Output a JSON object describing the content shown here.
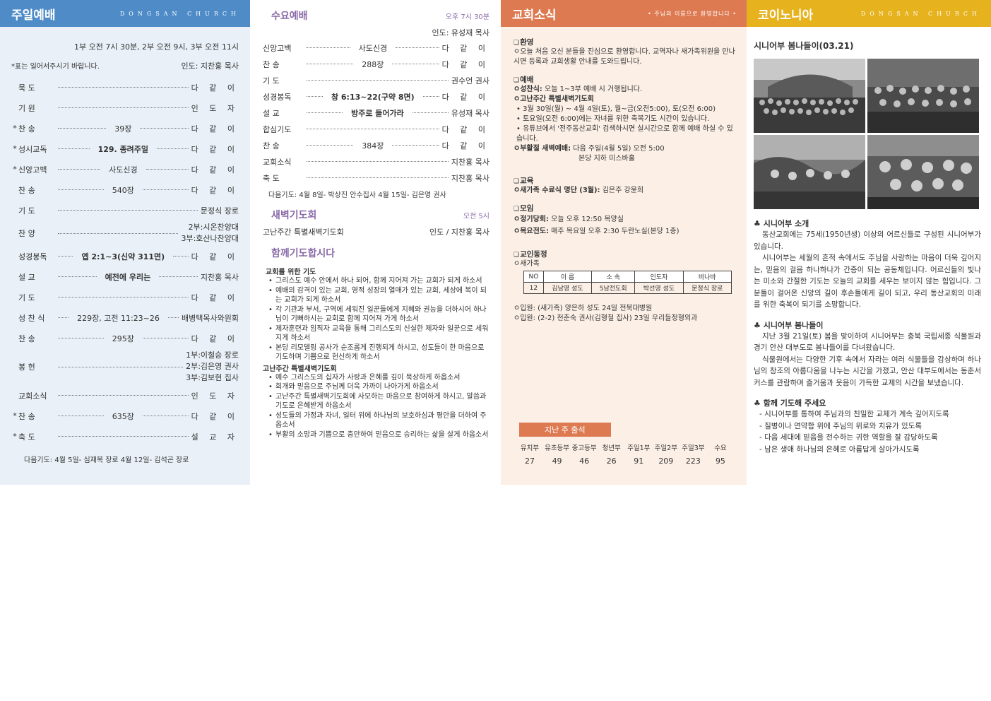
{
  "col1": {
    "title": "주일예배",
    "church": "DONGSAN CHURCH",
    "times": "1부 오전 7시 30분, 2부 오전 9시, 3부 오전 11시",
    "note": "*표는 일어서주시기 바랍니다.",
    "leader": "인도: 지찬홍 목사",
    "rows": [
      {
        "star": "",
        "label": "묵 도",
        "mid": "",
        "end": "다 같 이"
      },
      {
        "star": "",
        "label": "기 원",
        "mid": "",
        "end": "인 도 자"
      },
      {
        "star": "*",
        "label": "찬 송",
        "mid": "39장",
        "end": "다 같 이"
      },
      {
        "star": "*",
        "label": "성시교독",
        "mid": "129. 종려주일",
        "end": "다 같 이"
      },
      {
        "star": "*",
        "label": "신앙고백",
        "mid": "사도신경",
        "end": "다 같 이"
      },
      {
        "star": "",
        "label": "찬 송",
        "mid": "540장",
        "end": "다 같 이"
      },
      {
        "star": "",
        "label": "기 도",
        "mid": "",
        "end": "문정식 장로"
      },
      {
        "star": "",
        "label": "찬 양",
        "mid": "",
        "end1": "2부:시온찬양대",
        "end2": "3부:호산나찬양대"
      },
      {
        "star": "",
        "label": "성경봉독",
        "mid": "엡 2:1~3(신약 311면)",
        "end": "다 같 이"
      },
      {
        "star": "",
        "label": "설 교",
        "mid": "예전에 우리는",
        "end": "지찬홍 목사"
      },
      {
        "star": "",
        "label": "기 도",
        "mid": "",
        "end": "다 같 이"
      },
      {
        "star": "",
        "label": "성 찬 식",
        "mid": "229장, 고전 11:23~26",
        "end": "배병택목사와원회"
      },
      {
        "star": "",
        "label": "찬 송",
        "mid": "295장",
        "end": "다 같 이"
      },
      {
        "star": "",
        "label": "봉 헌",
        "mid": "",
        "end1": "1부:이철승 장로",
        "end2": "2부:김은영 권사",
        "end3": "3부:김보현 집사"
      },
      {
        "star": "",
        "label": "교회소식",
        "mid": "",
        "end": "인 도 자"
      },
      {
        "star": "*",
        "label": "찬 송",
        "mid": "635장",
        "end": "다 같 이"
      },
      {
        "star": "*",
        "label": "축 도",
        "mid": "",
        "end": "설 교 자"
      }
    ],
    "next": "다음기도: 4월 5일- 심재복 장로       4월 12일- 김석곤 장로"
  },
  "col2": {
    "title": "수요예배",
    "time": "오후 7시 30분",
    "leader": "인도: 유성재 목사",
    "rows": [
      {
        "label": "신앙고백",
        "mid": "사도신경",
        "end": "다 같 이"
      },
      {
        "label": "찬 송",
        "mid": "288장",
        "end": "다 같 이"
      },
      {
        "label": "기 도",
        "mid": "",
        "end": "권수언 권사"
      },
      {
        "label": "성경봉독",
        "mid": "창 6:13~22(구약 8면)",
        "end": "다 같 이"
      },
      {
        "label": "설 교",
        "mid": "방주로 들어가라",
        "end": "유성재 목사"
      },
      {
        "label": "합심기도",
        "mid": "",
        "end": "다 같 이"
      },
      {
        "label": "찬 송",
        "mid": "384장",
        "end": "다 같 이"
      },
      {
        "label": "교회소식",
        "mid": "",
        "end": "지찬홍 목사"
      },
      {
        "label": "축 도",
        "mid": "",
        "end": "지찬홍 목사"
      }
    ],
    "next": "다음기도: 4월 8일- 박상진 안수집사      4월 15일- 김은영 권사",
    "dawn_title": "새벽기도회",
    "dawn_time": "오전 5시",
    "dawn_name": "고난주간 특별새벽기도회",
    "dawn_leader": "인도 / 지찬홍 목사",
    "pray_title": "함께기도합시다",
    "pray_h1": "교회를 위한 기도",
    "pray_items1": [
      "그리스도 예수 안에서 하나 되어, 함께 지어져 가는 교회가 되게 하소서",
      "예배의 감격이 있는 교회, 영적 성장의 열매가 있는 교회, 세상에 복이 되는 교회가 되게 하소서",
      "각 기관과 부서, 구역에 세워진 일꾼들에게 지혜와 권능을 더하시어 하나님이 기뻐하시는 교회로 함께 지어져 가게 하소서",
      "제자훈련과 임직자 교육을 통해 그리스도의 신실한 제자와 일꾼으로 세워지게 하소서",
      "본당 리모델링 공사가 순조롭게 진행되게 하시고, 성도들이 한 마음으로 기도하며 기쁨으로 헌신하게 하소서"
    ],
    "pray_h2": "고난주간 특별새벽기도회",
    "pray_items2": [
      "예수 그리스도의 십자가 사랑과 은혜를 깊이 묵상하게 하옵소서",
      "회개와 믿음으로 주님께 더욱 가까이 나아가게 하옵소서",
      "고난주간 특별새벽기도회에 사모하는 마음으로 참여하게 하시고, 말씀과 기도로 은혜받게 하옵소서",
      "성도들의 가정과 자녀, 일터 위에 하나님의 보호하심과 평안을 더하여 주옵소서",
      "부활의 소망과 기쁨으로 충만하여 믿음으로 승리하는 삶을 살게 하옵소서"
    ]
  },
  "col3": {
    "title": "교회소식",
    "motto": "• 주님의 이름으로 환영합니다 •",
    "welcome_h": "환영",
    "welcome": "ㅇ오늘 처음 오신 분들을 진심으로 환영합니다. 교역자나 새가족위원을 만나시면 등록과 교회생활 안내를 도와드립니다.",
    "worship_h": "예배",
    "worship_1b": "ㅇ성찬식:",
    "worship_1": " 오늘 1~3부 예배 시 거행됩니다.",
    "worship_2b": "ㅇ고난주간 특별새벽기도회",
    "worship_2a": "• 3월 30일(월) ~ 4월 4일(토), 월~금(오전5:00), 토(오전 6:00)",
    "worship_2c": "• 토요일(오전 6:00)에는 자녀를 위한 축복기도 시간이 있습니다.",
    "worship_2d": "• 유튜브에서 '전주동산교회' 검색하시면 실시간으로 함께 예배 하실 수 있습니다.",
    "worship_3b": "ㅇ부활절 새벽예배:",
    "worship_3": " 다음 주일(4월 5일) 오전 5:00",
    "worship_3x": "본당 지하 미스바홀",
    "edu_h": "교육",
    "edu_b": "ㅇ새가족 수료식 명단 (3월):",
    "edu": " 김은주 강윤희",
    "meet_h": "모임",
    "meet_1b": "ㅇ정기당회:",
    "meet_1": " 오늘 오후 12:50 목양실",
    "meet_2b": "ㅇ목요전도:",
    "meet_2": " 매주 목요일 오후 2:30 두란노실(본당 1층)",
    "people_h": "교인동정",
    "newfam": "ㅇ새가족",
    "table_head": [
      "NO",
      "이 름",
      "소 속",
      "인도자",
      "바나바"
    ],
    "table_row": [
      "12",
      "김남영 성도",
      "5남전도회",
      "박선영 성도",
      "문정식 장로"
    ],
    "hosp_1": "ㅇ입원: (새가족) 양은하 성도 24일 전북대병원",
    "hosp_2": "ㅇ입원: (2-2) 천춘숙 권사(김형철 집사) 23일 우리들정형외과",
    "att_title": "지난 주 출석",
    "att_labels": [
      "유치부",
      "유초등부",
      "중고등부",
      "청년부",
      "주일1부",
      "주일2부",
      "주일3부",
      "수요"
    ],
    "att_values": [
      "27",
      "49",
      "46",
      "26",
      "91",
      "209",
      "223",
      "95"
    ]
  },
  "col4": {
    "title": "코이노니아",
    "church": "DONGSAN CHURCH",
    "sub": "시니어부 봄나들이(03.21)",
    "h1": "시니어부 소개",
    "p1": "동산교회에는 75세(1950년생) 이상의 어르신들로 구성된 시니어부가 있습니다.",
    "p2": "시니어부는 세월의 흔적 속에서도 주님을 사랑하는 마음이 더욱 깊어지는, 믿음의 걸음 하나하나가 간증이 되는 공동체입니다. 어르신들의 빛나는 미소와 간절한 기도는 오늘의 교회를 세우는 보이지 않는 힘입니다. 그분들이 걸어온 신앙의 길이 후손들에게 길이 되고, 우리 동산교회의 미래를 위한 축복이 되기를 소망합니다.",
    "h2": "시니어부 봄나들이",
    "p3": "지난 3월 21일(토) 봄을 맞이하여 시니어부는 충북 국립세종 식물원과 경기 안산 대부도로 봄나들이를 다녀왔습니다.",
    "p4": "식물원에서는 다양한 기후 속에서 자라는 여러 식물들을 감상하며 하나님의 창조의 아름다움을 나누는 시간을 가졌고, 안산 대부도에서는 동춘서커스를 관람하며 즐거움과 웃음이 가득한 교제의 시간을 보냈습니다.",
    "h3": "함께 기도해 주세요",
    "prays": [
      "시니어부를 통하여 주님과의 친밀한 교제가 계속 깊어지도록",
      "질병이나 연약함 위에 주님의 위로와 치유가 있도록",
      "다음 세대에 믿음을 전수하는 귀한 역할을 잘 감당하도록",
      "남은 생애 하나님의 은혜로 아름답게 살아가시도록"
    ]
  }
}
